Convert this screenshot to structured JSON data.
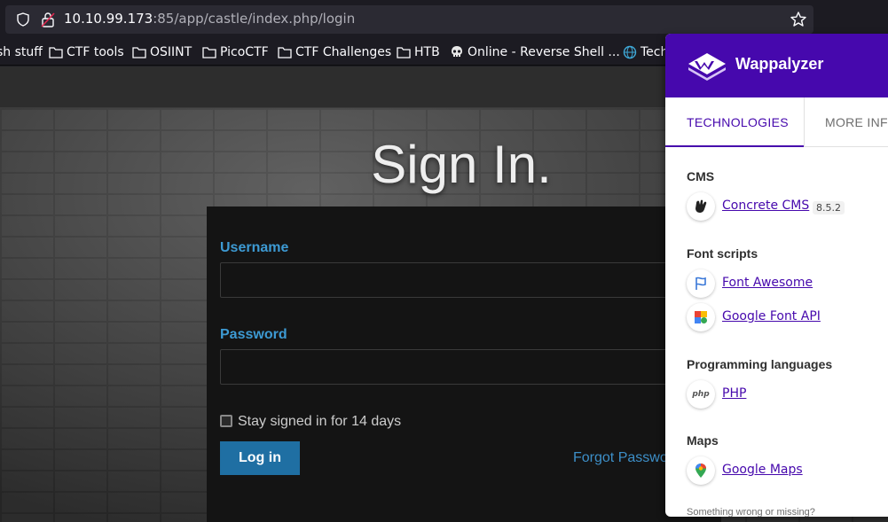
{
  "browser": {
    "url_host": "10.10.99.173",
    "url_rest": ":85/app/castle/index.php/login",
    "bookmarks": [
      {
        "label": "sh stuff",
        "icon": "none"
      },
      {
        "label": "CTF tools",
        "icon": "folder-icon"
      },
      {
        "label": "OSIINT",
        "icon": "folder-icon"
      },
      {
        "label": "PicoCTF",
        "icon": "folder-icon"
      },
      {
        "label": "CTF Challenges",
        "icon": "folder-icon"
      },
      {
        "label": "HTB",
        "icon": "folder-icon"
      },
      {
        "label": "Online - Reverse Shell ...",
        "icon": "skull-icon"
      },
      {
        "label": "Tech",
        "icon": "globe-icon"
      }
    ]
  },
  "login": {
    "title": "Sign In.",
    "username_label": "Username",
    "username_value": "",
    "password_label": "Password",
    "password_value": "",
    "remember_label": "Stay signed in for 14 days",
    "remember_checked": false,
    "login_button": "Log in",
    "forgot_link": "Forgot Passwo"
  },
  "wappalyzer": {
    "brand": "Wappalyzer",
    "tabs": [
      {
        "label": "TECHNOLOGIES",
        "active": true
      },
      {
        "label": "MORE INFO",
        "active": false
      }
    ],
    "categories": [
      {
        "name": "CMS",
        "techs": [
          {
            "name": "Concrete CMS",
            "version": "8.5.2",
            "icon": "concrete-cms-icon"
          }
        ]
      },
      {
        "name": "Font scripts",
        "techs": [
          {
            "name": "Font Awesome",
            "version": "",
            "icon": "font-awesome-flag-icon"
          },
          {
            "name": "Google Font API",
            "version": "",
            "icon": "google-font-api-icon"
          }
        ]
      },
      {
        "name": "Programming languages",
        "techs": [
          {
            "name": "PHP",
            "version": "",
            "icon": "php-icon"
          }
        ]
      },
      {
        "name": "Maps",
        "techs": [
          {
            "name": "Google Maps",
            "version": "",
            "icon": "google-maps-icon"
          }
        ]
      }
    ],
    "footer": "Something wrong or missing?"
  },
  "colors": {
    "wappalyzer_purple": "#4608ad",
    "login_label_blue": "#3d9ad3",
    "login_button_blue": "#1f6fa3"
  }
}
